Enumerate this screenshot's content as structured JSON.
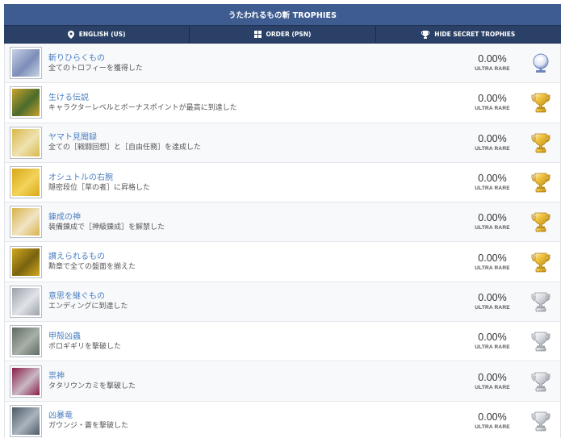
{
  "header": {
    "title": "うたわれるもの斬 TROPHIES"
  },
  "tabs": [
    {
      "label": "ENGLISH (US)",
      "icon": "location-pin-icon"
    },
    {
      "label": "ORDER (PSN)",
      "icon": "grid-icon"
    },
    {
      "label": "HIDE SECRET TROPHIES",
      "icon": "trophy-icon"
    }
  ],
  "colors": {
    "title_bar": "#3e5c8f",
    "tab_bar": "#2a4066",
    "link": "#4a7fc1",
    "gold": "#d6a419",
    "silver": "#a8adb4",
    "platinum": "#7f95c8"
  },
  "trophies": [
    {
      "name": "斬りひらくもの",
      "desc": "全てのトロフィーを獲得した",
      "pct": "0.00%",
      "rarity": "ULTRA RARE",
      "grade": "platinum",
      "thumb": [
        "#c9d3e6",
        "#7c8db8"
      ]
    },
    {
      "name": "生ける伝説",
      "desc": "キャラクターレベルとボーナスポイントが最高に到達した",
      "pct": "0.00%",
      "rarity": "ULTRA RARE",
      "grade": "gold",
      "thumb": [
        "#c8a22e",
        "#4b6b2b"
      ]
    },
    {
      "name": "ヤマト見聞録",
      "desc": "全ての［戦闘回想］と［自由任務］を達成した",
      "pct": "0.00%",
      "rarity": "ULTRA RARE",
      "grade": "gold",
      "thumb": [
        "#d8b84a",
        "#efe2b0"
      ]
    },
    {
      "name": "オシュトルの右腕",
      "desc": "隠密段位［草の者］に昇格した",
      "pct": "0.00%",
      "rarity": "ULTRA RARE",
      "grade": "gold",
      "thumb": [
        "#d8a818",
        "#f3d35a"
      ]
    },
    {
      "name": "錬成の神",
      "desc": "装備錬成で［神級錬成］を解禁した",
      "pct": "0.00%",
      "rarity": "ULTRA RARE",
      "grade": "gold",
      "thumb": [
        "#d7b24a",
        "#f1e4c4"
      ]
    },
    {
      "name": "讃えられるもの",
      "desc": "勲章で全ての盤面を揃えた",
      "pct": "0.00%",
      "rarity": "ULTRA RARE",
      "grade": "gold",
      "thumb": [
        "#d1a81c",
        "#7a6310"
      ]
    },
    {
      "name": "意思を継ぐもの",
      "desc": "エンディングに到達した",
      "pct": "0.00%",
      "rarity": "ULTRA RARE",
      "grade": "silver",
      "thumb": [
        "#9aa0a8",
        "#e0e3e8"
      ]
    },
    {
      "name": "甲殻凶蟲",
      "desc": "ボロギギリを撃破した",
      "pct": "0.00%",
      "rarity": "ULTRA RARE",
      "grade": "silver",
      "thumb": [
        "#5e6b63",
        "#a8b0a8"
      ]
    },
    {
      "name": "祟神",
      "desc": "タタリウンカミを撃破した",
      "pct": "0.00%",
      "rarity": "ULTRA RARE",
      "grade": "silver",
      "thumb": [
        "#8a1d4a",
        "#c8b8c4"
      ]
    },
    {
      "name": "凶暴竜",
      "desc": "ガウンジ・蒼を撃破した",
      "pct": "0.00%",
      "rarity": "ULTRA RARE",
      "grade": "silver",
      "thumb": [
        "#4c5966",
        "#aab4be"
      ]
    }
  ]
}
